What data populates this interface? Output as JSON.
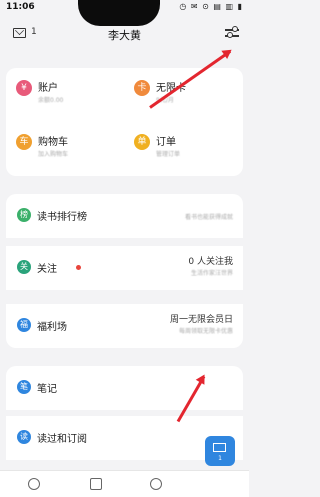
{
  "status_bar": {
    "time": "11:06",
    "icons": "◷ ✉ ⊙ ▤ ▥ ▮"
  },
  "header": {
    "mail_count": "1",
    "title": "李大黄"
  },
  "grid": [
    {
      "label": "账户",
      "sub": "余额0.00",
      "icon": "wallet-icon",
      "color": "#e85a7a",
      "glyph": "¥"
    },
    {
      "label": "无限卡",
      "sub": "9元/月",
      "icon": "card-icon",
      "color": "#f08a3c",
      "glyph": "卡"
    },
    {
      "label": "购物车",
      "sub": "加入购物车",
      "icon": "cart-icon",
      "color": "#f0a030",
      "glyph": "车"
    },
    {
      "label": "订单",
      "sub": "管理订单",
      "icon": "order-icon",
      "color": "#f0b020",
      "glyph": "单"
    }
  ],
  "rows": [
    {
      "label": "读书排行榜",
      "right1": "",
      "right2": "看书也能获得成就",
      "icon": "ranking-icon",
      "color": "#3bb06a",
      "glyph": "榜"
    },
    {
      "label": "关注",
      "right1": "0 人关注我",
      "right2": "生活作家汪世界",
      "icon": "follow-icon",
      "color": "#2aa37b",
      "glyph": "关"
    },
    {
      "label": "福利场",
      "right1": "周一无限会员日",
      "right2": "每周领取无限卡优惠",
      "icon": "gift-icon",
      "color": "#2f86df",
      "glyph": "福"
    },
    {
      "label": "笔记",
      "right1": "",
      "right2": "",
      "icon": "note-icon",
      "color": "#2f86df",
      "glyph": "笔"
    },
    {
      "label": "读过和订阅",
      "right1": "",
      "right2": "",
      "icon": "read-icon",
      "color": "#2f86df",
      "glyph": "读"
    }
  ],
  "fab": {
    "count": "1"
  },
  "colors": {
    "arrow": "#e3262f",
    "accent": "#2f86df"
  }
}
